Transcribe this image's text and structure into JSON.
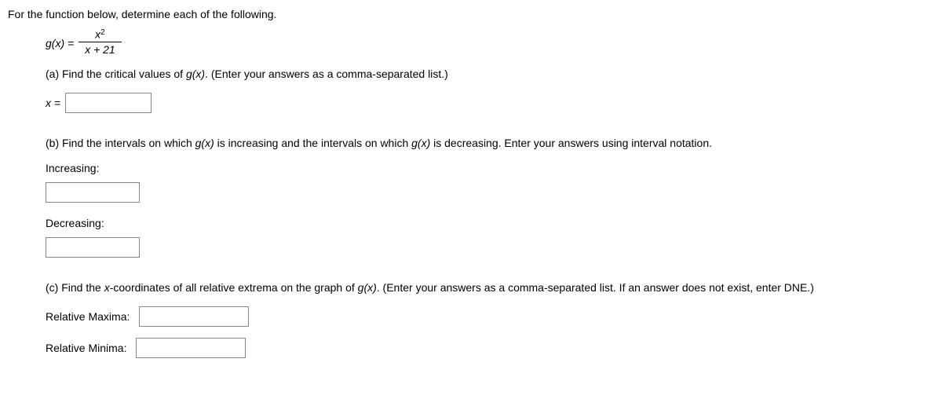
{
  "intro": "For the function below, determine each of the following.",
  "function": {
    "lhs": "g(x) = ",
    "num_var": "x",
    "num_exp": "2",
    "den": "x + 21"
  },
  "partA": {
    "prefix": "(a) Find the critical values of ",
    "fn": "g(x)",
    "suffix": ". (Enter your answers as a comma-separated list.)",
    "label": "x ="
  },
  "partB": {
    "prefix": "(b) Find the intervals on which ",
    "fn": "g(x)",
    "mid": " is increasing and the intervals on which ",
    "fn2": "g(x)",
    "suffix": " is decreasing. Enter your answers using interval notation.",
    "increasing_label": "Increasing:",
    "decreasing_label": "Decreasing:"
  },
  "partC": {
    "prefix": "(c) Find the ",
    "xcoord": "x",
    "mid": "-coordinates of all relative extrema on the graph of ",
    "fn": "g(x)",
    "suffix": ". (Enter your answers as a comma-separated list. If an answer does not exist, enter DNE.)",
    "maxima_label": "Relative Maxima:",
    "minima_label": "Relative Minima:"
  }
}
